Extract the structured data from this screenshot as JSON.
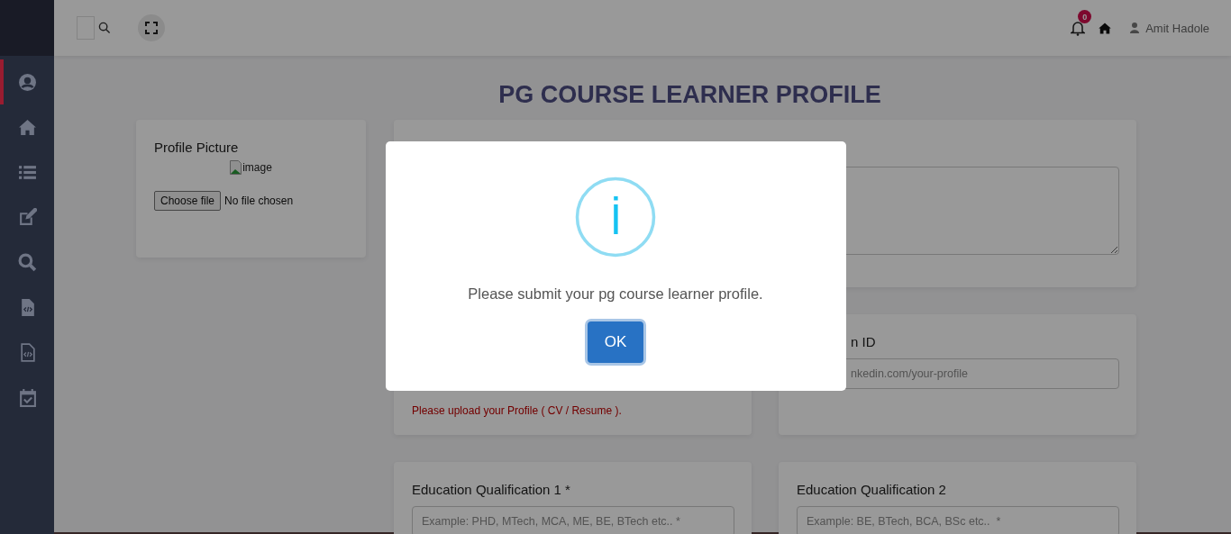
{
  "header": {
    "notifications": {
      "count": "0"
    },
    "user": {
      "name": "Amit Hadole"
    }
  },
  "sidebar": {
    "items": [
      {
        "kind": "user",
        "selected": true
      },
      {
        "kind": "home",
        "selected": false
      },
      {
        "kind": "list",
        "selected": false
      },
      {
        "kind": "edit",
        "selected": false
      },
      {
        "kind": "search",
        "selected": false
      },
      {
        "kind": "code-file",
        "selected": false
      },
      {
        "kind": "code-file-outline",
        "selected": false
      },
      {
        "kind": "calendar-check",
        "selected": false
      }
    ]
  },
  "title": "PG COURSE LEARNER PROFILE",
  "profile_picture": {
    "label": "Profile Picture",
    "image_alt": "image",
    "file_button": "Choose file",
    "file_status": "No file chosen"
  },
  "cards": [
    {
      "kind": "textarea"
    },
    {
      "kind": "upload",
      "error": "Please upload your Profile ( CV / Resume )."
    },
    {
      "kind": "partial-input",
      "label": "n ID",
      "placeholder": "nkedin.com/your-profile"
    },
    {
      "kind": "input",
      "label": "Education Qualification 1 *",
      "placeholder": "Example: PHD, MTech, MCA, ME, BE, BTech etc.. *"
    },
    {
      "kind": "input",
      "label": "Education Qualification 2",
      "placeholder": "Example: BE, BTech, BCA, BSc etc..  *"
    }
  ],
  "modal": {
    "message": "Please submit your pg course learner profile.",
    "button": "OK"
  }
}
